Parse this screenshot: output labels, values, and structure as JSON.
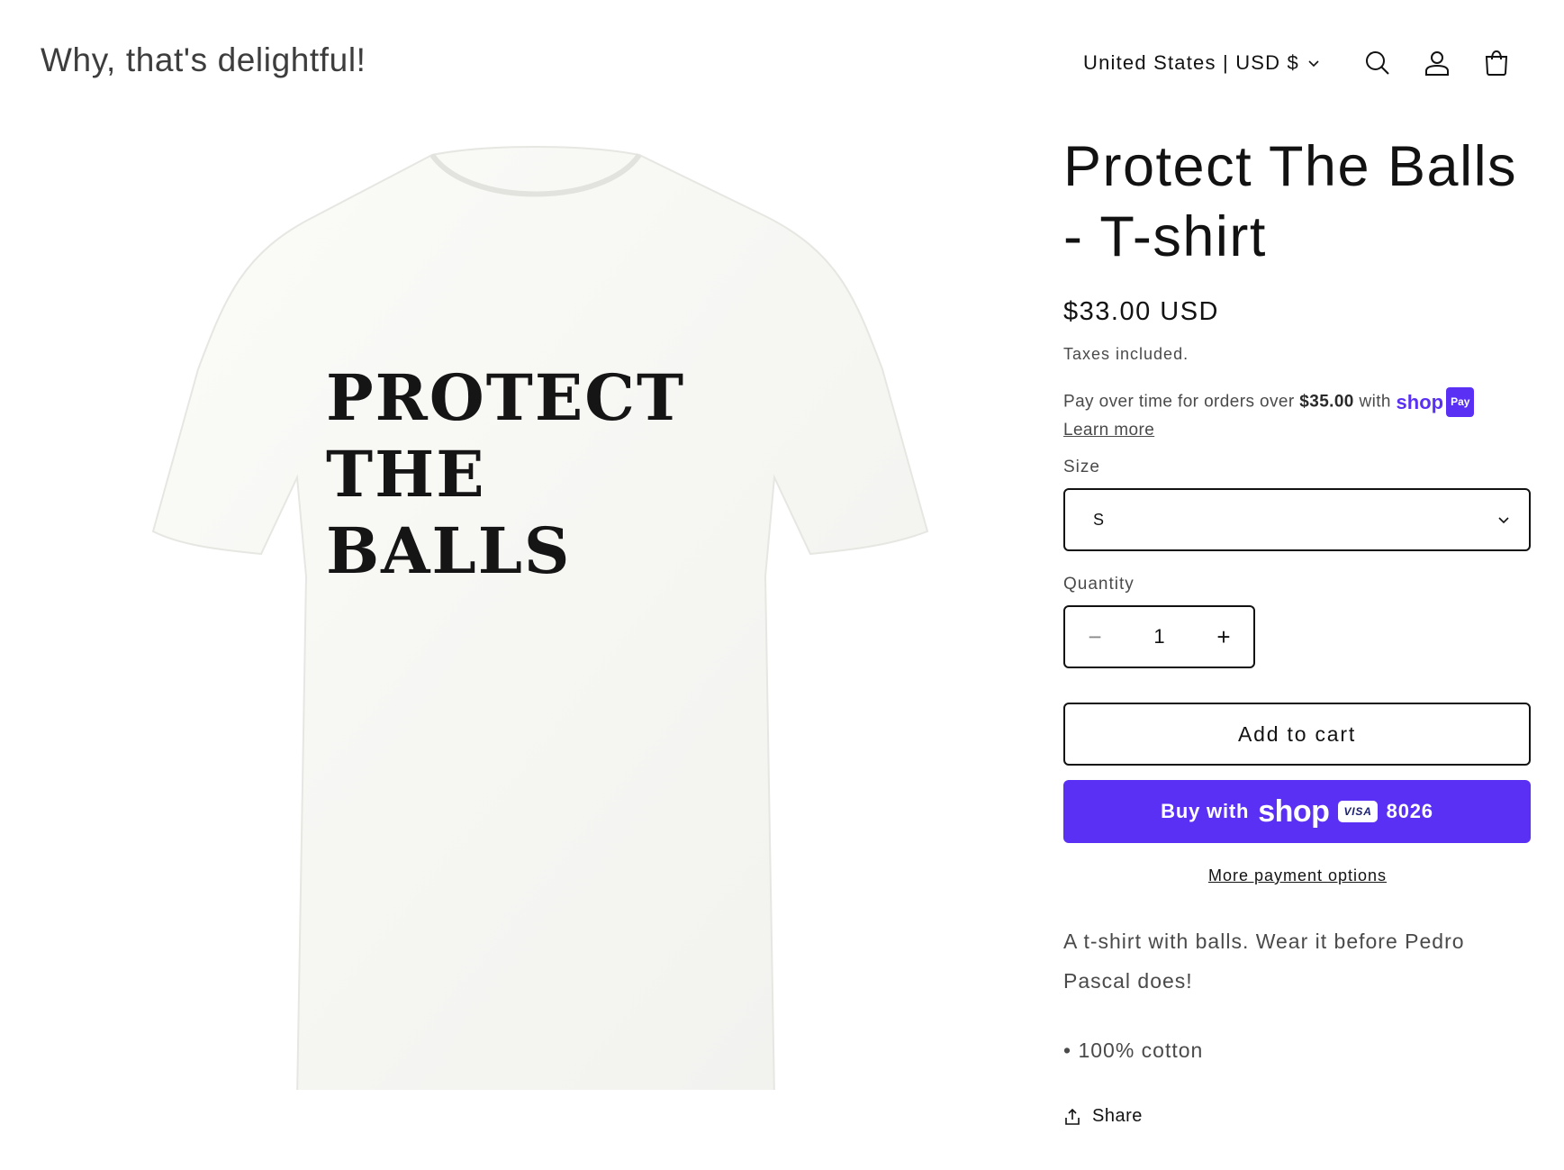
{
  "header": {
    "logo_text": "Why, that's delightful!",
    "localization": "United States | USD $",
    "icons": [
      "search-icon",
      "account-icon",
      "cart-icon"
    ]
  },
  "gallery": {
    "shirt_text_lines": [
      "PROTECT",
      "THE",
      "BALLS"
    ]
  },
  "product": {
    "title": "Protect The Balls - T-shirt",
    "price": "$33.00 USD",
    "taxes": "Taxes included.",
    "installments_prefix": "Pay over time for orders over ",
    "installments_amount": "$35.00",
    "installments_suffix": " with",
    "shop_pay_brand": "shop",
    "shop_pay_badge": "Pay",
    "learn_more": "Learn more",
    "size_label": "Size",
    "size_value": "S",
    "quantity_label": "Quantity",
    "quantity_value": "1",
    "minus_symbol": "−",
    "plus_symbol": "+",
    "add_to_cart": "Add to cart",
    "buy_prefix": "Buy with",
    "buy_brand": "shop",
    "card_brand": "VISA",
    "card_last4": "8026",
    "more_payment": "More payment options",
    "description": "A t-shirt with balls. Wear it before Pedro Pascal does!",
    "bullet": "• 100% cotton",
    "share": "Share"
  },
  "colors": {
    "accent": "#5a31f4",
    "text": "#121212",
    "muted": "#4a4a4a"
  }
}
